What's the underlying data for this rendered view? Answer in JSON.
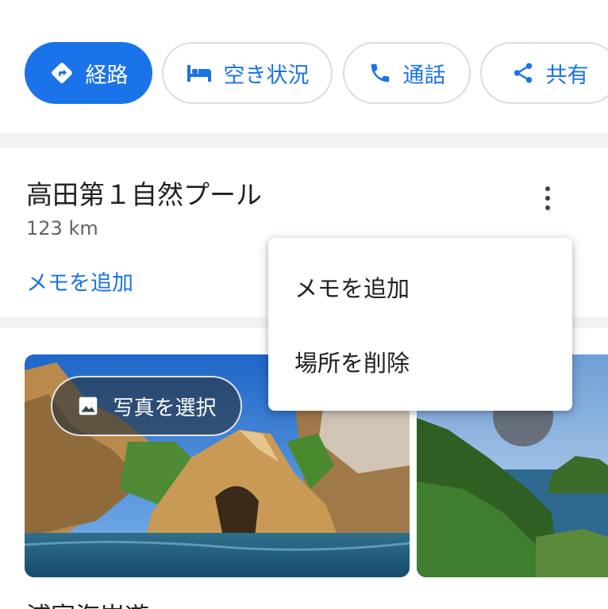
{
  "action_chips": {
    "directions_label": "経路",
    "availability_label": "空き状況",
    "call_label": "通話",
    "share_label": "共有"
  },
  "colors": {
    "accent": "#1a73e8",
    "text_primary": "#202124",
    "text_secondary": "#5f6368",
    "chip_border": "#dadce0"
  },
  "place": {
    "title": "高田第１自然プール",
    "distance": "123 km",
    "add_note_link": "メモを追加"
  },
  "photos": {
    "select_photo_label": "写真を選択"
  },
  "overflow_menu": {
    "items": [
      {
        "label": "メモを追加"
      },
      {
        "label": "場所を削除"
      }
    ]
  },
  "next_item_partial": "浦富海岸遊"
}
